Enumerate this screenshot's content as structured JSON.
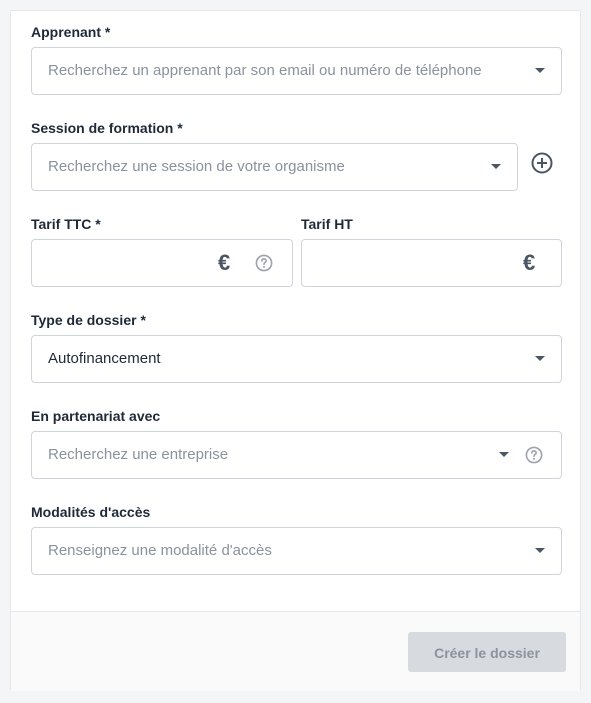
{
  "form": {
    "learner": {
      "label": "Apprenant *",
      "placeholder": "Recherchez un apprenant par son email ou numéro de téléphone"
    },
    "session": {
      "label": "Session de formation *",
      "placeholder": "Recherchez une session de votre organisme"
    },
    "price_ttc": {
      "label": "Tarif TTC *",
      "currency_symbol": "€"
    },
    "price_ht": {
      "label": "Tarif HT",
      "currency_symbol": "€"
    },
    "dossier_type": {
      "label": "Type de dossier *",
      "value": "Autofinancement"
    },
    "partnership": {
      "label": "En partenariat avec",
      "placeholder": "Recherchez une entreprise"
    },
    "access": {
      "label": "Modalités d'accès",
      "placeholder": "Renseignez une modalité d'accès"
    }
  },
  "footer": {
    "create_label": "Créer le dossier"
  },
  "icons": {
    "add": "plus-circle-icon",
    "help": "question-circle-icon",
    "dropdown": "chevron-down-icon"
  },
  "colors": {
    "disabled_button_bg": "#d7dbe0",
    "disabled_button_text": "#8c939d",
    "border": "#d1d5db",
    "placeholder": "#8b929c"
  }
}
